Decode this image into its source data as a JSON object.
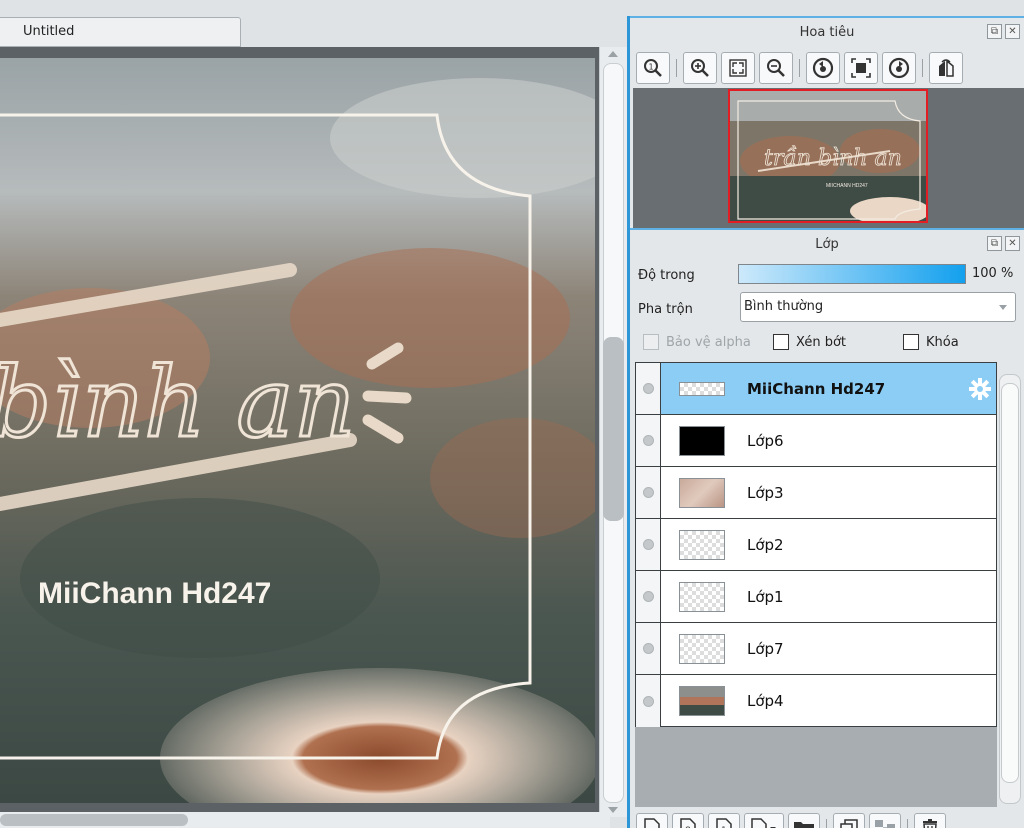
{
  "document": {
    "tab_title": "Untitled",
    "artwork": {
      "script_text": "bình an",
      "caption": "MiiChann Hd247"
    }
  },
  "navigator": {
    "title": "Hoa tiêu",
    "toolbar": [
      {
        "name": "zoom-actual-icon"
      },
      {
        "name": "zoom-in-icon"
      },
      {
        "name": "fit-screen-icon"
      },
      {
        "name": "zoom-out-icon"
      },
      {
        "name": "rotate-left-icon"
      },
      {
        "name": "fit-window-icon"
      },
      {
        "name": "rotate-right-icon"
      },
      {
        "name": "flip-icon"
      }
    ]
  },
  "layers": {
    "title": "Lớp",
    "opacity_label": "Độ trong",
    "opacity_value": "100 %",
    "opacity_fraction": 1.0,
    "blend_label": "Pha trộn",
    "blend_value": "Bình thường",
    "protect_alpha_label": "Bảo vệ alpha",
    "clipping_label": "Xén bớt",
    "lock_label": "Khóa",
    "items": [
      {
        "name": "MiiChann Hd247",
        "thumb": "text",
        "selected": true
      },
      {
        "name": "Lớp6",
        "thumb": "black",
        "selected": false
      },
      {
        "name": "Lớp3",
        "thumb": "photo-light",
        "selected": false
      },
      {
        "name": "Lớp2",
        "thumb": "empty",
        "selected": false
      },
      {
        "name": "Lớp1",
        "thumb": "empty",
        "selected": false
      },
      {
        "name": "Lớp7",
        "thumb": "empty",
        "selected": false
      },
      {
        "name": "Lớp4",
        "thumb": "photo",
        "selected": false
      }
    ]
  },
  "colors": {
    "accent": "#2c96d6",
    "selected_row": "#8bcdf4",
    "nav_frame": "#e21e24"
  }
}
